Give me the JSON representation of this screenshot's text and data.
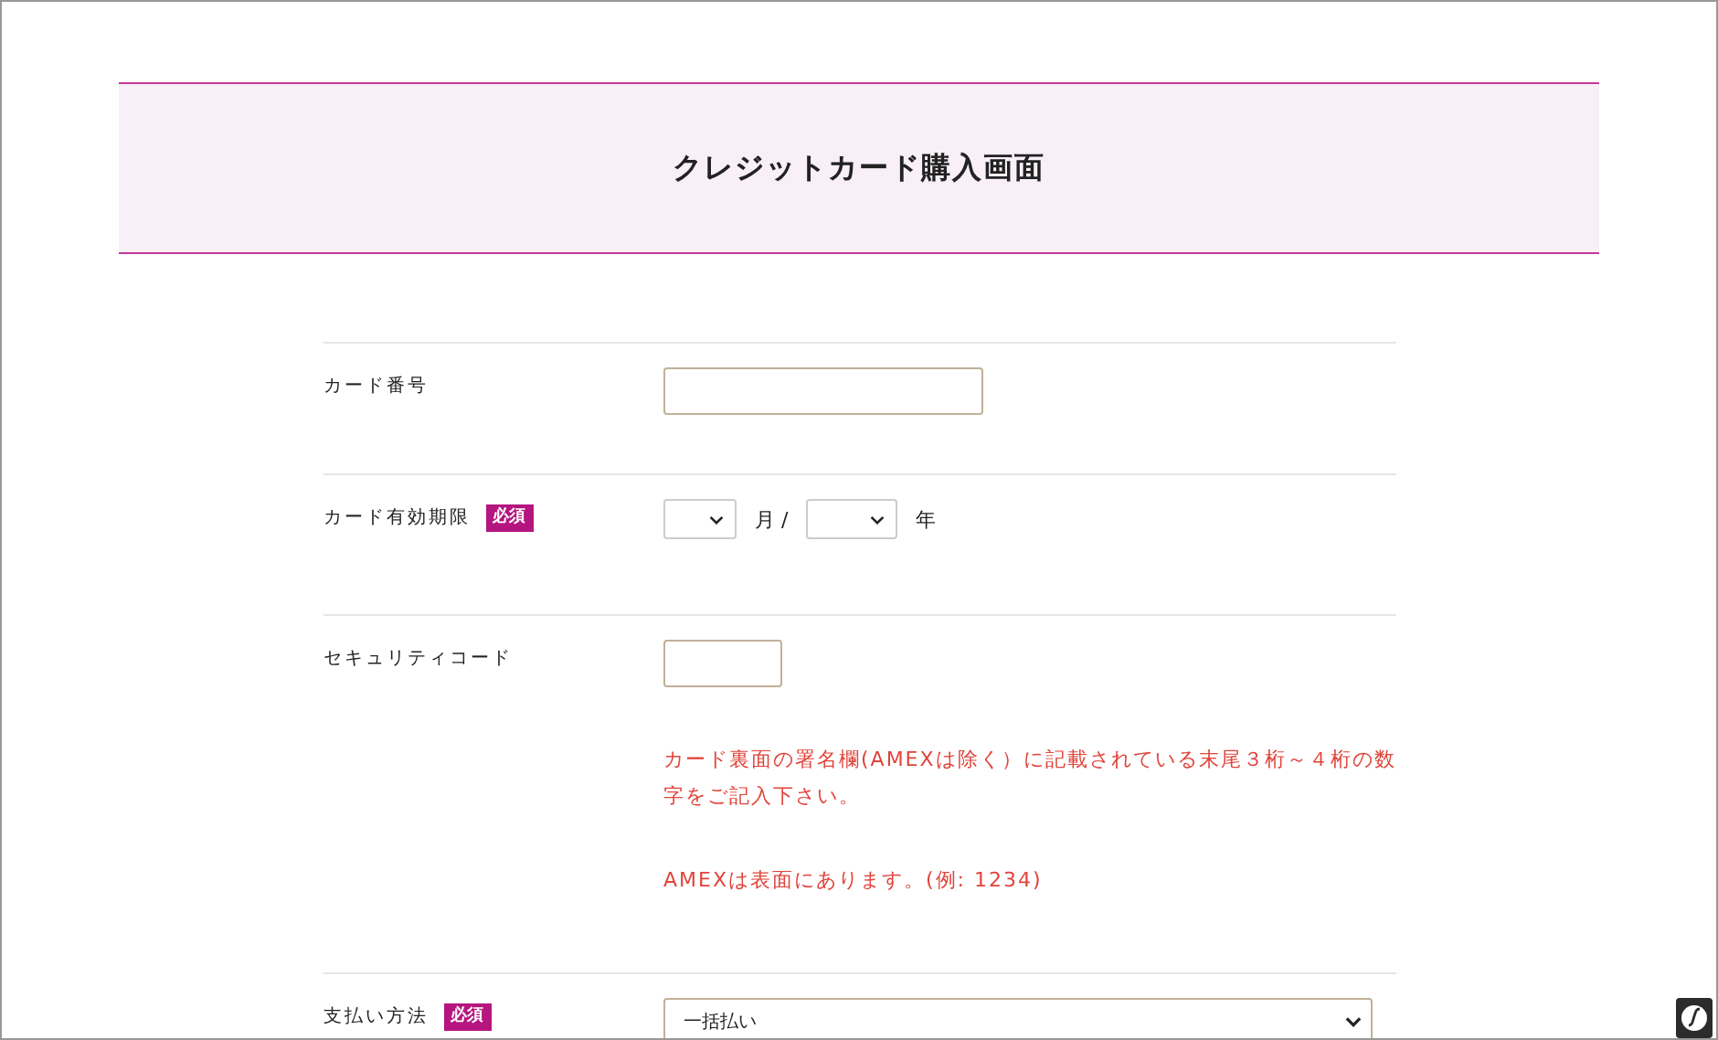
{
  "header": {
    "title": "クレジットカード購入画面"
  },
  "fields": [
    {
      "kind": "text",
      "label": "カード番号"
    },
    {
      "kind": "expiry",
      "label": "カード有効期限",
      "badge": "必須",
      "month_unit": "月 /",
      "year_unit": "年"
    },
    {
      "kind": "short_text",
      "label": "セキュリティコード",
      "notes": [
        "カード裏面の署名欄(AMEXは除く）に記載されている末尾３桁～４桁の数字をご記入下さい。",
        "AMEXは表面にあります。(例: 1234)"
      ]
    },
    {
      "kind": "select",
      "label": "支払い方法",
      "badge": "必須",
      "value": "一括払い"
    }
  ]
}
